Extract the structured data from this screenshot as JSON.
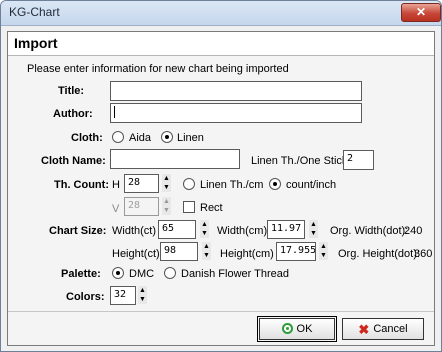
{
  "window": {
    "title": "KG-Chart",
    "close_glyph": "✕"
  },
  "header": {
    "title": "Import"
  },
  "intro": "Please enter information for new chart being imported",
  "title_field": {
    "label": "Title:",
    "value": ""
  },
  "author_field": {
    "label": "Author:",
    "value": ""
  },
  "cloth": {
    "label": "Cloth:",
    "options": [
      "Aida",
      "Linen"
    ],
    "selected": "Linen"
  },
  "cloth_name": {
    "label": "Cloth Name:",
    "value": ""
  },
  "linen_th": {
    "label": "Linen Th./One Stich",
    "value": "2"
  },
  "th_count": {
    "label": "Th. Count:",
    "h_label": "H",
    "h_value": "28",
    "v_label": "V",
    "v_value": "28",
    "unit_options": [
      "Linen Th./cm",
      "count/inch"
    ],
    "unit_selected": "count/inch",
    "rect_label": "Rect",
    "rect_checked": false
  },
  "chart_size": {
    "label": "Chart Size:",
    "width_ct_label": "Width(ct)",
    "width_ct": "65",
    "width_cm_label": "Width(cm)",
    "width_cm": "11.97",
    "org_width_label": "Org. Width(dot):",
    "org_width": "240",
    "height_ct_label": "Height(ct)",
    "height_ct": "98",
    "height_cm_label": "Height(cm)",
    "height_cm": "17.955",
    "org_height_label": "Org. Height(dot):",
    "org_height": "360"
  },
  "palette": {
    "label": "Palette:",
    "options": [
      "DMC",
      "Danish Flower Thread"
    ],
    "selected": "DMC"
  },
  "colors": {
    "label": "Colors:",
    "value": "32"
  },
  "buttons": {
    "ok": "OK",
    "cancel": "Cancel"
  },
  "icons": {
    "ok": "ok-circle-icon",
    "cancel": "cancel-x-icon",
    "spin_up": "▲",
    "spin_down": "▼"
  },
  "colors_theme": {
    "ok_icon": "#2e9e3a",
    "cancel_icon": "#d0271d",
    "titlebar": "#c6d6ec",
    "close": "#c7473a"
  }
}
